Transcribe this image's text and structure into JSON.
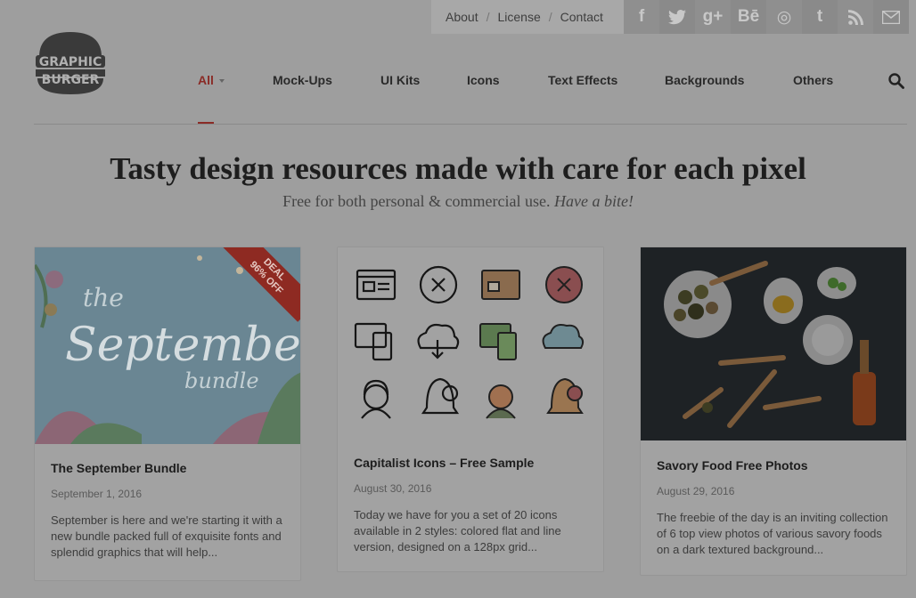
{
  "topnav": {
    "about": "About",
    "license": "License",
    "contact": "Contact"
  },
  "social": [
    {
      "icon": "facebook-icon",
      "glyph": "f"
    },
    {
      "icon": "twitter-icon",
      "glyph": "t"
    },
    {
      "icon": "google-plus-icon",
      "glyph": "g+"
    },
    {
      "icon": "behance-icon",
      "glyph": "Bē"
    },
    {
      "icon": "dribbble-icon",
      "glyph": "◎"
    },
    {
      "icon": "tumblr-icon",
      "glyph": "t"
    },
    {
      "icon": "rss-icon",
      "glyph": "≋"
    },
    {
      "icon": "mail-icon",
      "glyph": "✉"
    }
  ],
  "logo": {
    "line1": "GRAPHIC",
    "line2": "BURGER"
  },
  "nav": [
    {
      "label": "All",
      "active": true
    },
    {
      "label": "Mock-Ups"
    },
    {
      "label": "UI Kits"
    },
    {
      "label": "Icons"
    },
    {
      "label": "Text Effects"
    },
    {
      "label": "Backgrounds"
    },
    {
      "label": "Others"
    }
  ],
  "hero": {
    "title": "Tasty design resources made with care for each pixel",
    "subtitle": "Free for both personal & commercial use.",
    "subtitle_em": "Have a bite!"
  },
  "posts": [
    {
      "title": "The September Bundle",
      "date": "September 1, 2016",
      "excerpt": "September is here and we're starting it with a new bundle packed full of exquisite fonts and splendid graphics that will help...",
      "badge_line1": "DEAL",
      "badge_line2": "96% OFF",
      "thumb_text1": "the",
      "thumb_text2": "September",
      "thumb_text3": "bundle"
    },
    {
      "title": "Capitalist Icons – Free Sample",
      "date": "August 30, 2016",
      "excerpt": "Today we have for you a set of 20 icons available in 2 styles: colored flat and line version, designed on a 128px grid..."
    },
    {
      "title": "Savory Food Free Photos",
      "date": "August 29, 2016",
      "excerpt": "The freebie of the day is an inviting collection of 6 top view photos of various savory foods on a dark textured background..."
    }
  ],
  "colors": {
    "accent": "#8a2b26",
    "background": "#9e9e9e"
  }
}
